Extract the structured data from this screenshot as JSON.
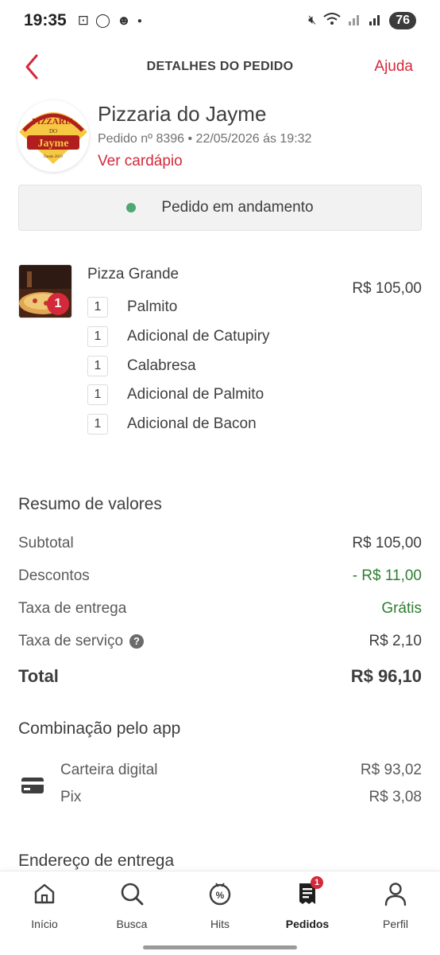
{
  "status_bar": {
    "time": "19:35",
    "battery": "76"
  },
  "header": {
    "title": "DETALHES DO PEDIDO",
    "help_label": "Ajuda"
  },
  "store": {
    "name": "Pizzaria do Jayme",
    "logo_text_top": "PIZZARIA",
    "logo_text_mid": "DO",
    "logo_text_main": "Jayme",
    "logo_text_since": "Desde 2013",
    "meta": "Pedido nº 8396 • 22/05/2026 ás 19:32",
    "menu_link": "Ver cardápio"
  },
  "order_status": {
    "text": "Pedido em andamento",
    "color": "#50a773"
  },
  "item": {
    "name": "Pizza Grande",
    "quantity": "1",
    "price": "R$ 105,00",
    "addons": [
      {
        "qty": "1",
        "name": "Palmito"
      },
      {
        "qty": "1",
        "name": "Adicional de Catupiry"
      },
      {
        "qty": "1",
        "name": "Calabresa"
      },
      {
        "qty": "1",
        "name": "Adicional de Palmito"
      },
      {
        "qty": "1",
        "name": "Adicional de Bacon"
      }
    ]
  },
  "summary": {
    "title": "Resumo de valores",
    "subtotal_label": "Subtotal",
    "subtotal_value": "R$ 105,00",
    "discount_label": "Descontos",
    "discount_value": "- R$ 11,00",
    "delivery_label": "Taxa de entrega",
    "delivery_value": "Grátis",
    "service_label": "Taxa de serviço",
    "service_value": "R$ 2,10",
    "total_label": "Total",
    "total_value": "R$ 96,10"
  },
  "payment": {
    "title": "Combinação pelo app",
    "methods": [
      {
        "name": "Carteira digital",
        "value": "R$ 93,02"
      },
      {
        "name": "Pix",
        "value": "R$ 3,08"
      }
    ]
  },
  "address": {
    "title": "Endereço de entrega"
  },
  "nav": {
    "items": [
      {
        "label": "Início",
        "icon": "home-icon"
      },
      {
        "label": "Busca",
        "icon": "search-icon"
      },
      {
        "label": "Hits",
        "icon": "discount-icon"
      },
      {
        "label": "Pedidos",
        "icon": "orders-icon",
        "badge": "1"
      },
      {
        "label": "Perfil",
        "icon": "profile-icon"
      }
    ]
  },
  "colors": {
    "accent": "#d4293a",
    "success": "#2e7d32"
  }
}
